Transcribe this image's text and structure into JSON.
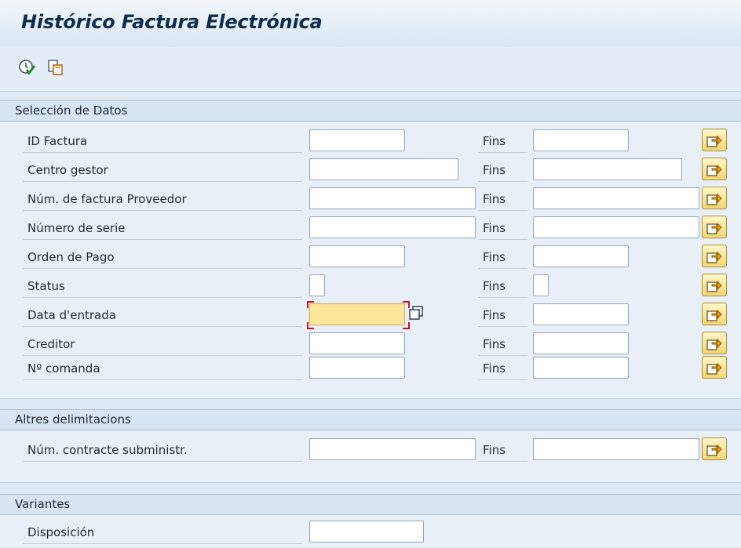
{
  "title": "Histórico Factura Electrónica",
  "toolbar": {
    "execute_icon": "execute-clock-icon",
    "copy_icon": "copy-variant-icon"
  },
  "sections": {
    "seleccion": {
      "header": "Selección de Datos",
      "fins_label": "Fins",
      "rows": [
        {
          "label": "ID Factura",
          "value": "",
          "to_value": ""
        },
        {
          "label": "Centro gestor",
          "value": "",
          "to_value": ""
        },
        {
          "label": "Núm. de factura Proveedor",
          "value": "",
          "to_value": ""
        },
        {
          "label": "Número de serie",
          "value": "",
          "to_value": ""
        },
        {
          "label": "Orden de Pago",
          "value": "",
          "to_value": ""
        },
        {
          "label": "Status",
          "value": "",
          "to_value": ""
        },
        {
          "label": "Data d'entrada",
          "value": "",
          "to_value": ""
        },
        {
          "label": "Creditor",
          "value": "",
          "to_value": ""
        },
        {
          "label": "Nº comanda",
          "value": "",
          "to_value": ""
        }
      ]
    },
    "altres": {
      "header": "Altres delimitacions",
      "fins_label": "Fins",
      "rows": [
        {
          "label": "Núm. contracte subministr.",
          "value": "",
          "to_value": ""
        }
      ]
    },
    "variantes": {
      "header": "Variantes",
      "rows": [
        {
          "label": "Disposición",
          "value": ""
        }
      ]
    }
  },
  "colors": {
    "accent_title": "#0e2d4d",
    "focus_field": "#fde59a",
    "button_yellow": "#f3d673",
    "focus_corner": "#c8102e"
  }
}
